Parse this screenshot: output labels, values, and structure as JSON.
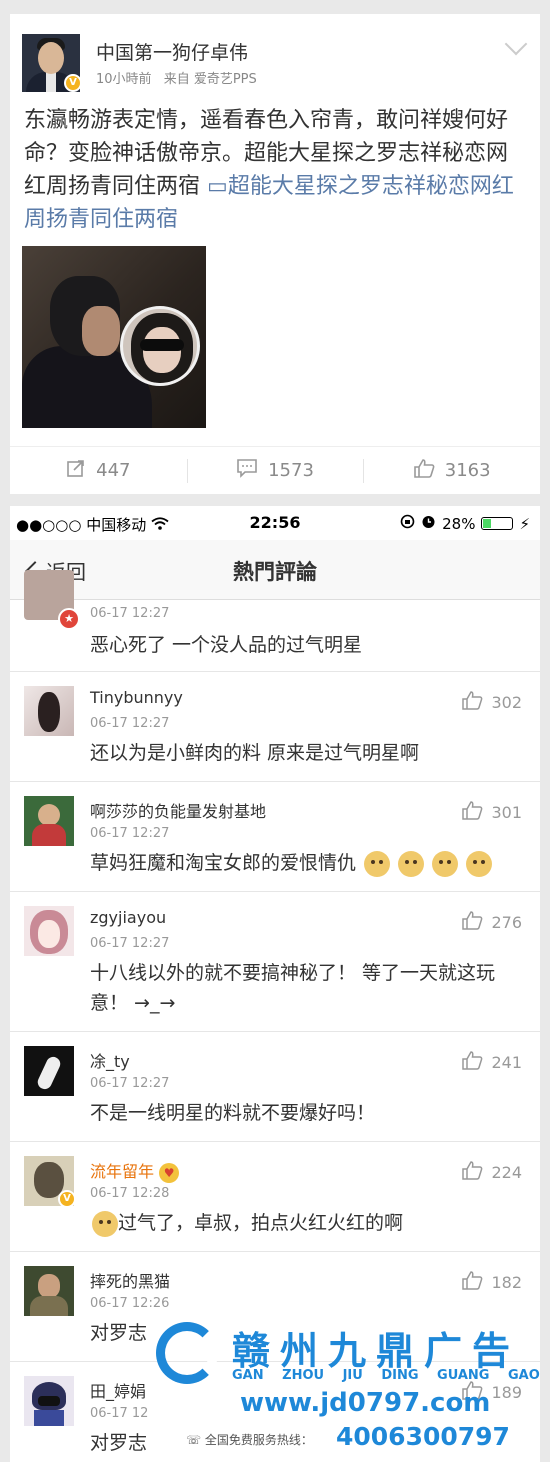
{
  "post": {
    "author": "中国第一狗仔卓伟",
    "verified": "V",
    "time": "10小時前",
    "source": "来自 爱奇艺PPS",
    "text": "东瀛畅游表定情，遥看春色入帘青，敢问祥嫂何好命？变脸神话傲帝京。超能大星探之罗志祥秘恋网红周扬青同住两宿",
    "link_icon": "video-link-icon",
    "link_text": "超能大星探之罗志祥秘恋网红周扬青同住两宿",
    "reposts": "447",
    "comments": "1573",
    "likes": "3163"
  },
  "status_bar": {
    "signal": "●●○○○",
    "carrier": "中国移动",
    "time": "22:56",
    "battery": "28%",
    "battery_level": 0.28
  },
  "nav": {
    "back": "返回",
    "title": "熱門評論"
  },
  "comments": [
    {
      "name": "",
      "time": "06-17 12:27",
      "text": "恶心死了 一个没人品的过气明星",
      "likes": ""
    },
    {
      "name": "Tinybunnyy",
      "time": "06-17 12:27",
      "text": "还以为是小鲜肉的料 原来是过气明星啊",
      "likes": "302"
    },
    {
      "name": "啊莎莎的负能量发射基地",
      "time": "06-17 12:27",
      "text": "草妈狂魔和淘宝女郎的爱恨情仇",
      "likes": "301"
    },
    {
      "name": "zgyjiayou",
      "time": "06-17 12:27",
      "text": "十八线以外的就不要搞神秘了！ 等了一天就这玩意！ →_→",
      "likes": "276"
    },
    {
      "name": "凃_ty",
      "time": "06-17 12:27",
      "text": "不是一线明星的料就不要爆好吗！",
      "likes": "241"
    },
    {
      "name": "流年留年",
      "time": "06-17 12:28",
      "text": "过气了，卓叔，拍点火红火红的啊",
      "likes": "224"
    },
    {
      "name": "摔死的黑猫",
      "time": "06-17 12:26",
      "text": "对罗志",
      "likes": "182"
    },
    {
      "name": "田_婷娟",
      "time": "06-17 12",
      "text": "对罗志",
      "likes": "189"
    }
  ],
  "watermark": {
    "brand": "赣州九鼎广告",
    "pinyin": "GAN ZHOU JIU DING GUANG GAO",
    "url": "www.jd0797.com",
    "hotline_label": "全国免费服务热线：",
    "phone": "4006300797"
  }
}
